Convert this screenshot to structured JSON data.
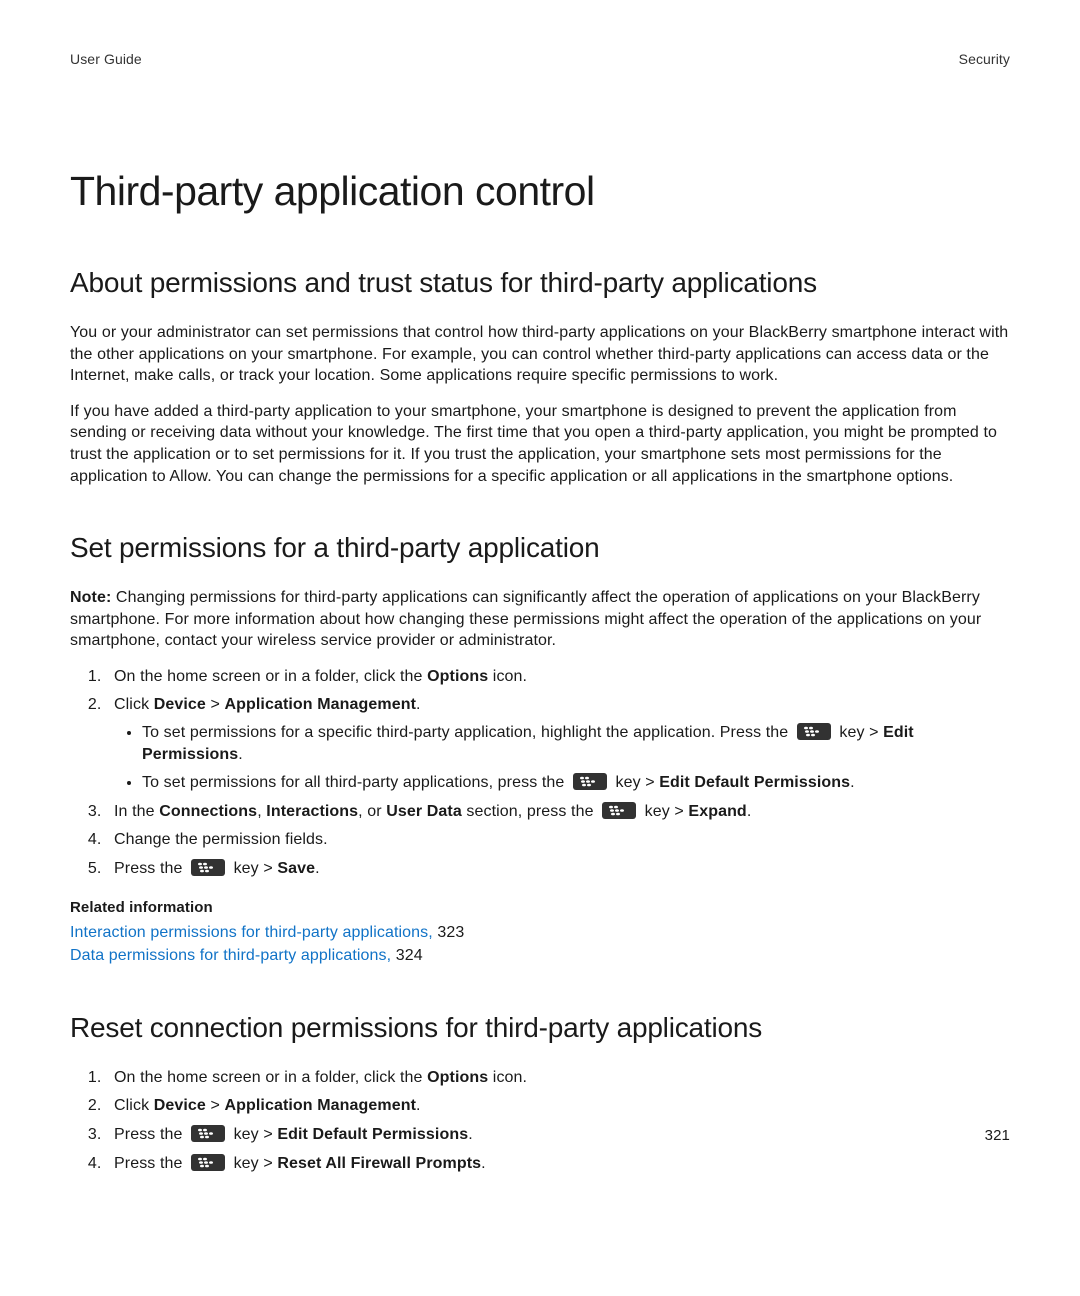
{
  "header": {
    "left": "User Guide",
    "right": "Security"
  },
  "h1": "Third-party application control",
  "section_about": {
    "h2": "About permissions and trust status for third-party applications",
    "p1": "You or your administrator can set permissions that control how third-party applications on your BlackBerry smartphone interact with the other applications on your smartphone. For example, you can control whether third-party applications can access data or the Internet, make calls, or track your location. Some applications require specific permissions to work.",
    "p2": "If you have added a third-party application to your smartphone, your smartphone is designed to prevent the application from sending or receiving data without your knowledge. The first time that you open a third-party application, you might be prompted to trust the application or to set permissions for it. If you trust the application, your smartphone sets most permissions for the application to Allow. You can change the permissions for a specific application or all applications in the smartphone options."
  },
  "section_set": {
    "h2": "Set permissions for a third-party application",
    "note_label": "Note:",
    "note_body": " Changing permissions for third-party applications can significantly affect the operation of applications on your BlackBerry smartphone. For more information about how changing these permissions might affect the operation of the applications on your smartphone, contact your wireless service provider or administrator.",
    "step1_pre": "On the home screen or in a folder, click the ",
    "step1_bold": "Options",
    "step1_post": " icon.",
    "step2_pre": "Click ",
    "step2_b1": "Device",
    "step2_mid": " > ",
    "step2_b2": "Application Management",
    "step2_post": ".",
    "bullet1_pre": "To set permissions for a specific third-party application, highlight the application. Press the ",
    "bullet1_post_key": " key > ",
    "bullet1_b": "Edit Permissions",
    "bullet1_end": ".",
    "bullet2_pre": "To set permissions for all third-party applications, press the ",
    "bullet2_post_key": " key > ",
    "bullet2_b": "Edit Default Permissions",
    "bullet2_end": ".",
    "step3_pre": "In the ",
    "step3_b1": "Connections",
    "step3_mid1": ", ",
    "step3_b2": "Interactions",
    "step3_mid2": ", or ",
    "step3_b3": "User Data",
    "step3_mid3": " section, press the ",
    "step3_post_key": " key > ",
    "step3_b4": "Expand",
    "step3_end": ".",
    "step4": "Change the permission fields.",
    "step5_pre": "Press the ",
    "step5_post_key": " key > ",
    "step5_b": "Save",
    "step5_end": ".",
    "related_title": "Related information",
    "link1_text": "Interaction permissions for third-party applications, ",
    "link1_page": "323",
    "link2_text": "Data permissions for third-party applications, ",
    "link2_page": "324"
  },
  "section_reset": {
    "h2": "Reset connection permissions for third-party applications",
    "step1_pre": "On the home screen or in a folder, click the ",
    "step1_bold": "Options",
    "step1_post": " icon.",
    "step2_pre": "Click ",
    "step2_b1": "Device",
    "step2_mid": " > ",
    "step2_b2": "Application Management",
    "step2_post": ".",
    "step3_pre": "Press the ",
    "step3_post_key": " key > ",
    "step3_b": "Edit Default Permissions",
    "step3_end": ".",
    "step4_pre": "Press the ",
    "step4_post_key": " key > ",
    "step4_b": "Reset All Firewall Prompts",
    "step4_end": "."
  },
  "page_number": "321"
}
